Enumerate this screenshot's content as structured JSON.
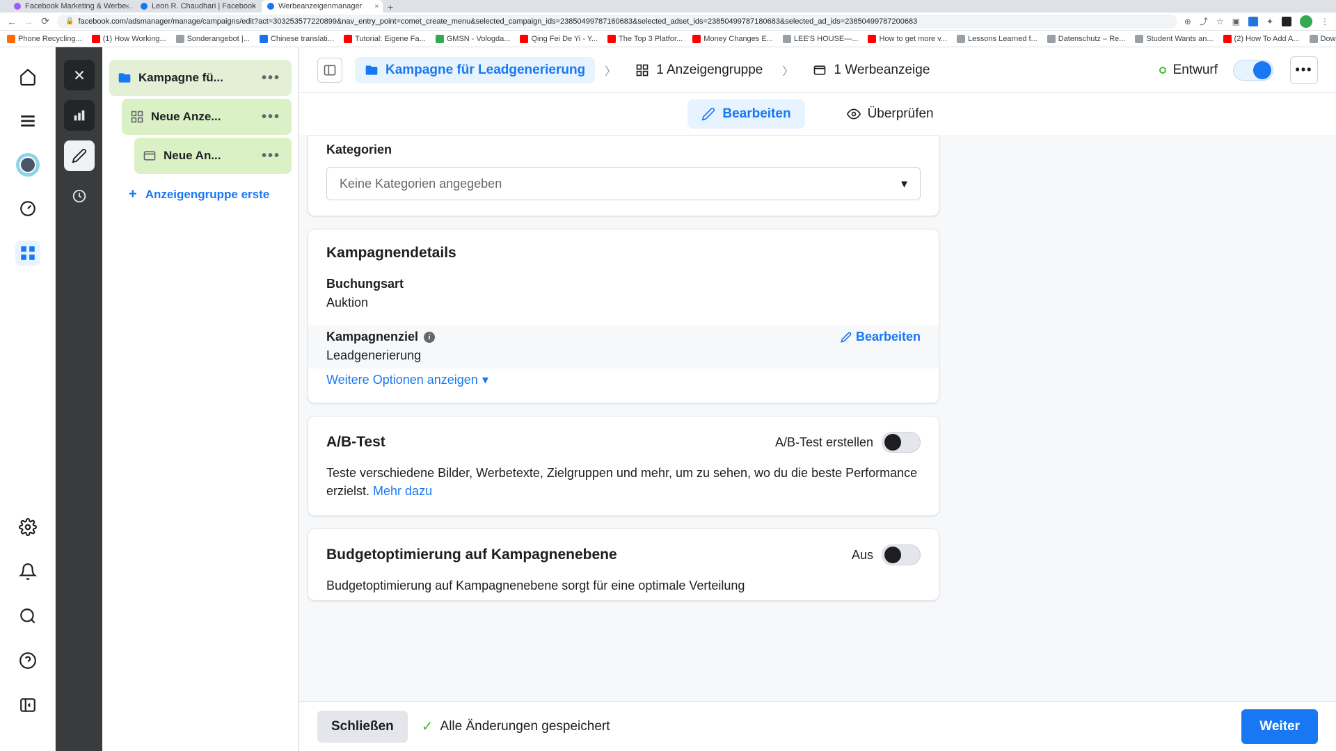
{
  "browser": {
    "tabs": [
      {
        "title": "Facebook Marketing & Werbe...",
        "favicon": "#a259ff"
      },
      {
        "title": "Leon R. Chaudhari | Facebook",
        "favicon": "#1877f2"
      },
      {
        "title": "Werbeanzeigenmanager",
        "favicon": "#1877f2"
      }
    ],
    "url": "facebook.com/adsmanager/manage/campaigns/edit?act=303253577220899&nav_entry_point=comet_create_menu&selected_campaign_ids=23850499787160683&selected_adset_ids=23850499787180683&selected_ad_ids=23850499787200683",
    "bookmarks": [
      {
        "label": "Phone Recycling...",
        "color": "orange"
      },
      {
        "label": "(1) How Working...",
        "color": "red"
      },
      {
        "label": "Sonderangebot |...",
        "color": "gray"
      },
      {
        "label": "Chinese translati...",
        "color": "blue"
      },
      {
        "label": "Tutorial: Eigene Fa...",
        "color": "red"
      },
      {
        "label": "GMSN - Vologda...",
        "color": "green"
      },
      {
        "label": "Qing Fei De Yi - Y...",
        "color": "red"
      },
      {
        "label": "The Top 3 Platfor...",
        "color": "red"
      },
      {
        "label": "Money Changes E...",
        "color": "red"
      },
      {
        "label": "LEE'S HOUSE—...",
        "color": "gray"
      },
      {
        "label": "How to get more v...",
        "color": "red"
      },
      {
        "label": "Lessons Learned f...",
        "color": "gray"
      },
      {
        "label": "Datenschutz – Re...",
        "color": "gray"
      },
      {
        "label": "Student Wants an...",
        "color": "gray"
      },
      {
        "label": "(2) How To Add A...",
        "color": "red"
      },
      {
        "label": "Download - Cooki...",
        "color": "gray"
      }
    ]
  },
  "tree": {
    "campaign": "Kampagne fü...",
    "adset": "Neue Anze...",
    "ad": "Neue An...",
    "add_group": "Anzeigengruppe erste"
  },
  "breadcrumb": {
    "campaign": "Kampagne für Leadgenerierung",
    "adset": "1 Anzeigengruppe",
    "ad": "1 Werbeanzeige"
  },
  "status": {
    "label": "Entwurf"
  },
  "tabs": {
    "edit": "Bearbeiten",
    "review": "Überprüfen"
  },
  "categories": {
    "heading": "Kategorien",
    "placeholder": "Keine Kategorien angegeben"
  },
  "details": {
    "heading": "Kampagnendetails",
    "booking_label": "Buchungsart",
    "booking_value": "Auktion",
    "goal_label": "Kampagnenziel",
    "goal_value": "Leadgenerierung",
    "edit": "Bearbeiten",
    "more": "Weitere Optionen anzeigen"
  },
  "abtest": {
    "heading": "A/B-Test",
    "toggle_label": "A/B-Test erstellen",
    "body": "Teste verschiedene Bilder, Werbetexte, Zielgruppen und mehr, um zu sehen, wo du die beste Performance erzielst. ",
    "link": "Mehr dazu"
  },
  "budget": {
    "heading": "Budgetoptimierung auf Kampagnenebene",
    "toggle_label": "Aus",
    "body": "Budgetoptimierung auf Kampagnenebene sorgt für eine optimale Verteilung"
  },
  "footer": {
    "close": "Schließen",
    "saved": "Alle Änderungen gespeichert",
    "next": "Weiter"
  }
}
